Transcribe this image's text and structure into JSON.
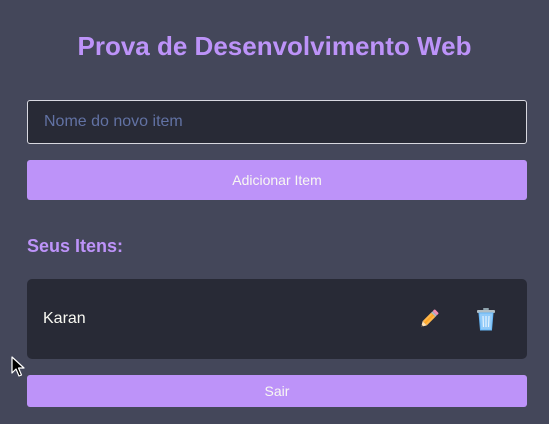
{
  "page": {
    "title": "Prova de Desenvolvimento Web"
  },
  "form": {
    "input_placeholder": "Nome do novo item",
    "input_value": "",
    "add_button_label": "Adicionar Item"
  },
  "list": {
    "heading": "Seus Itens:",
    "items": [
      {
        "name": "Karan",
        "edit_icon": "pencil-icon",
        "delete_icon": "trash-icon"
      }
    ]
  },
  "logout_button_label": "Sair",
  "colors": {
    "background": "#44475a",
    "accent": "#bd93f9",
    "card": "#282a36",
    "text": "#f8f8f2"
  }
}
